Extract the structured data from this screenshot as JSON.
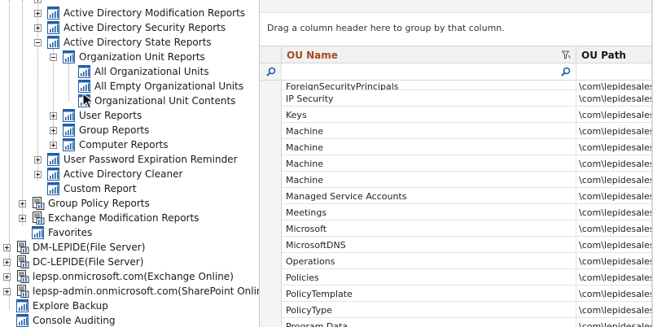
{
  "tree": {
    "items": [
      {
        "label": "Active Directory Modification Reports",
        "indent": 2,
        "expander": "plus",
        "icon": "report"
      },
      {
        "label": "Active Directory Security Reports",
        "indent": 2,
        "expander": "plus",
        "icon": "report"
      },
      {
        "label": "Active Directory State Reports",
        "indent": 2,
        "expander": "minus",
        "icon": "report"
      },
      {
        "label": "Organization Unit Reports",
        "indent": 3,
        "expander": "minus",
        "icon": "report"
      },
      {
        "label": "All Organizational Units",
        "indent": 4,
        "expander": "none",
        "icon": "report"
      },
      {
        "label": "All Empty Organizational Units",
        "indent": 4,
        "expander": "none",
        "icon": "report"
      },
      {
        "label": "Organizational Unit Contents",
        "indent": 4,
        "expander": "none",
        "icon": "report"
      },
      {
        "label": "User Reports",
        "indent": 3,
        "expander": "plus",
        "icon": "report"
      },
      {
        "label": "Group Reports",
        "indent": 3,
        "expander": "plus",
        "icon": "report"
      },
      {
        "label": "Computer Reports",
        "indent": 3,
        "expander": "plus",
        "icon": "report"
      },
      {
        "label": "User Password Expiration Reminder",
        "indent": 2,
        "expander": "plus",
        "icon": "report"
      },
      {
        "label": "Active Directory Cleaner",
        "indent": 2,
        "expander": "plus",
        "icon": "report"
      },
      {
        "label": "Custom Report",
        "indent": 2,
        "expander": "none",
        "icon": "report"
      },
      {
        "label": "Group Policy Reports",
        "indent": 1,
        "expander": "plus",
        "icon": "server"
      },
      {
        "label": "Exchange Modification Reports",
        "indent": 1,
        "expander": "plus",
        "icon": "server"
      },
      {
        "label": "Favorites",
        "indent": 1,
        "expander": "none",
        "icon": "report"
      },
      {
        "label": "DM-LEPIDE(File Server)",
        "indent": 0,
        "expander": "plus",
        "icon": "server"
      },
      {
        "label": "DC-LEPIDE(File Server)",
        "indent": 0,
        "expander": "plus",
        "icon": "server"
      },
      {
        "label": "lepsp.onmicrosoft.com(Exchange Online)",
        "indent": 0,
        "expander": "plus",
        "icon": "server"
      },
      {
        "label": "lepsp-admin.onmicrosoft.com(SharePoint Online)",
        "indent": 0,
        "expander": "plus",
        "icon": "server"
      },
      {
        "label": "Explore Backup",
        "indent": 0,
        "expander": "none",
        "icon": "report"
      },
      {
        "label": "Console Auditing",
        "indent": 0,
        "expander": "none",
        "icon": "report"
      }
    ]
  },
  "grid": {
    "group_hint": "Drag a column header here to group by that column.",
    "columns": [
      "OU Name",
      "OU Path"
    ],
    "rows": [
      {
        "name": "ForeignSecurityPrincipals",
        "path": "\\com\\lepidesales\\F"
      },
      {
        "name": "IP Security",
        "path": "\\com\\lepidesales\\S"
      },
      {
        "name": "Keys",
        "path": "\\com\\lepidesales\\K"
      },
      {
        "name": "Machine",
        "path": "\\com\\lepidesales\\S"
      },
      {
        "name": "Machine",
        "path": "\\com\\lepidesales\\S"
      },
      {
        "name": "Machine",
        "path": "\\com\\lepidesales\\S"
      },
      {
        "name": "Machine",
        "path": "\\com\\lepidesales\\S"
      },
      {
        "name": "Managed Service Accounts",
        "path": "\\com\\lepidesales\\M"
      },
      {
        "name": "Meetings",
        "path": "\\com\\lepidesales\\S"
      },
      {
        "name": "Microsoft",
        "path": "\\com\\lepidesales\\S"
      },
      {
        "name": "MicrosoftDNS",
        "path": "\\com\\lepidesales\\S"
      },
      {
        "name": "Operations",
        "path": "\\com\\lepidesales\\S"
      },
      {
        "name": "Policies",
        "path": "\\com\\lepidesales\\S"
      },
      {
        "name": "PolicyTemplate",
        "path": "\\com\\lepidesales\\S"
      },
      {
        "name": "PolicyType",
        "path": "\\com\\lepidesales\\S"
      },
      {
        "name": "Program Data",
        "path": "\\com\\lepidesales\\P"
      }
    ]
  },
  "icons": {
    "report": "report-icon",
    "server": "server-icon",
    "filter": "filter-icon",
    "search": "search-icon"
  },
  "colors": {
    "ou_header": "#a34c22",
    "icon_blue": "#1f5fa8"
  }
}
